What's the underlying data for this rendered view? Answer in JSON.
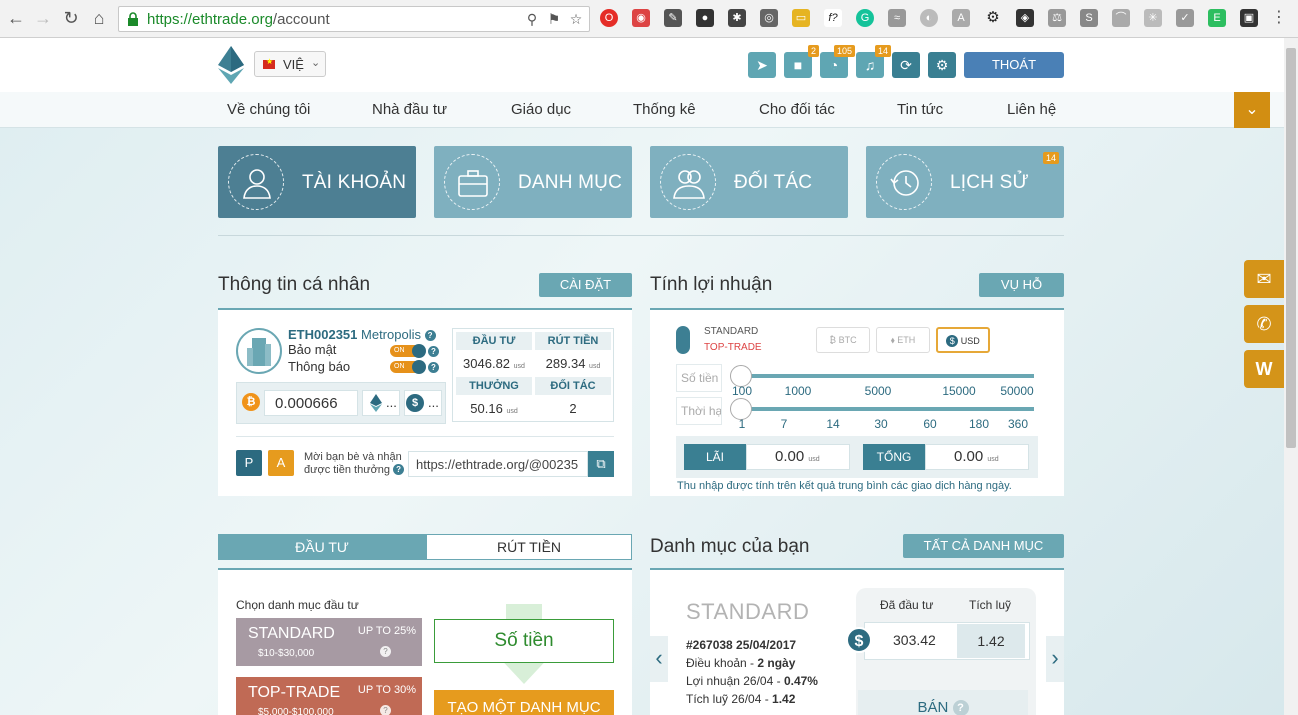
{
  "browser": {
    "url_host": "https://ethtrade.org",
    "url_path": "/account"
  },
  "header": {
    "language": "VIỆ",
    "badges": {
      "video": "2",
      "rss": "105",
      "bell": "14"
    },
    "logout": "THOÁT"
  },
  "nav": {
    "items": [
      "Về chúng tôi",
      "Nhà đầu tư",
      "Giáo dục",
      "Thống kê",
      "Cho đối tác",
      "Tin tức",
      "Liên hệ"
    ]
  },
  "tabs": [
    {
      "label": "TÀI KHOẢN",
      "active": true
    },
    {
      "label": "DANH MỤC",
      "active": false
    },
    {
      "label": "ĐỐI TÁC",
      "active": false
    },
    {
      "label": "LỊCH SỬ",
      "active": false,
      "badge": "14"
    }
  ],
  "personal": {
    "title": "Thông tin cá nhân",
    "settings_btn": "CÀI ĐẶT",
    "user_id": "ETH002351",
    "city": "Metropolis",
    "security_label": "Bảo mật",
    "notify_label": "Thông báo",
    "toggle_on": "ON",
    "wallet_btc": "0.000666",
    "wallet_eth": "...",
    "wallet_usd": "...",
    "stats": {
      "invest_h": "ĐẦU TƯ",
      "withdraw_h": "RÚT TIỀN",
      "invest_v": "3046.82",
      "withdraw_v": "289.34",
      "bonus_h": "THƯỞNG",
      "partner_h": "ĐỐI TÁC",
      "bonus_v": "50.16",
      "partner_v": "2",
      "unit": "usd"
    },
    "btn_p": "P",
    "btn_a": "A",
    "invite_text": "Mời bạn bè và nhận được tiền thưởng",
    "ref_link": "https://ethtrade.org/@00235"
  },
  "calc": {
    "title": "Tính lợi nhuận",
    "help_btn": "VỤ HỖ",
    "plan_standard": "STANDARD",
    "plan_toptrade": "TOP-TRADE",
    "currencies": [
      "BTC",
      "ETH",
      "USD"
    ],
    "amount_label": "Số tiền",
    "period_label": "Thời hạn",
    "amount_ticks": [
      "100",
      "1000",
      "5000",
      "15000",
      "50000"
    ],
    "period_ticks": [
      "1",
      "7",
      "14",
      "30",
      "60",
      "180",
      "360"
    ],
    "profit_h": "LÃI",
    "total_h": "TỔNG",
    "profit_v": "0.00",
    "total_v": "0.00",
    "unit": "usd",
    "note": "Thu nhập được tính trên kết quả trung bình các giao dịch hàng ngày."
  },
  "invest": {
    "tab_invest": "ĐẦU TƯ",
    "tab_withdraw": "RÚT TIỀN",
    "choose": "Chọn danh mục đầu tư",
    "plans": [
      {
        "name": "STANDARD",
        "up": "UP TO 25%",
        "range": "$10-$30,000",
        "color": "#a79aa3"
      },
      {
        "name": "TOP-TRADE",
        "up": "UP TO 30%",
        "range": "$5,000-$100,000",
        "color": "#c06a55"
      }
    ],
    "amount": "Số tiền",
    "create": "TẠO MỘT DANH MỤC"
  },
  "portfolio": {
    "title": "Danh mục của bạn",
    "all_btn": "TẤT CẢ DANH MỤC",
    "plan": "STANDARD",
    "id_date": "#267038 25/04/2017",
    "terms_label": "Điều khoản - ",
    "terms_value": "2 ngày",
    "profit_label": "Lợi nhuận 26/04 - ",
    "profit_value": "0.47%",
    "accum_label": "Tích luỹ 26/04 - ",
    "accum_value": "1.42",
    "col_invested": "Đã đầu tư",
    "col_accum": "Tích luỹ",
    "invested": "303.42",
    "accum": "1.42",
    "sell": "BÁN"
  }
}
